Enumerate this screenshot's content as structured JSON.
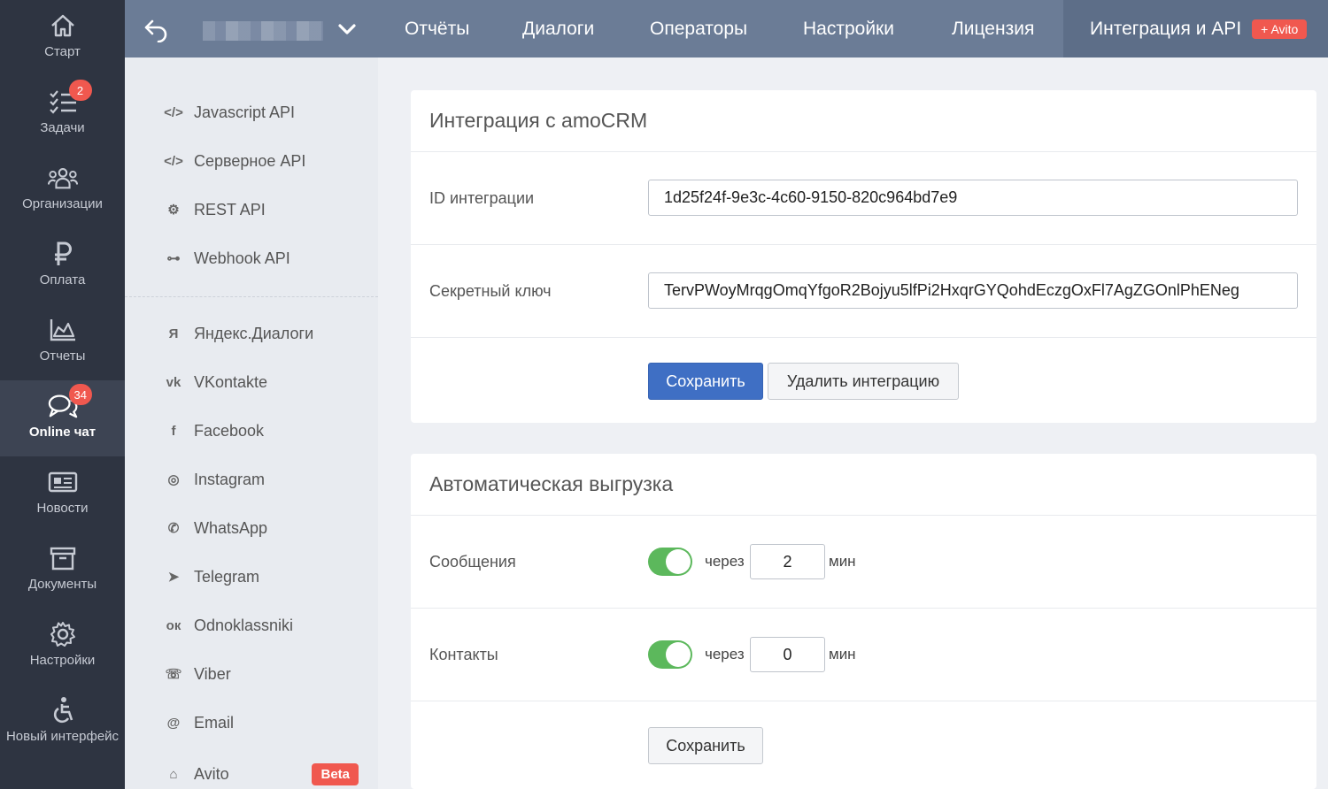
{
  "sidebar": {
    "items": [
      {
        "label": "Старт",
        "icon": "home-icon"
      },
      {
        "label": "Задачи",
        "icon": "tasks-icon",
        "badge": "2"
      },
      {
        "label": "Организации",
        "icon": "organizations-icon"
      },
      {
        "label": "Оплата",
        "icon": "ruble-icon"
      },
      {
        "label": "Отчеты",
        "icon": "chart-icon"
      },
      {
        "label": "Online чат",
        "icon": "chat-icon",
        "badge": "34",
        "active": true
      },
      {
        "label": "Новости",
        "icon": "news-icon"
      },
      {
        "label": "Документы",
        "icon": "archive-icon"
      },
      {
        "label": "Настройки",
        "icon": "gear-icon"
      },
      {
        "label": "Новый интерфейс",
        "icon": "accessibility-icon"
      }
    ]
  },
  "topbar": {
    "tabs": [
      {
        "label": "Отчёты"
      },
      {
        "label": "Диалоги"
      },
      {
        "label": "Операторы"
      },
      {
        "label": "Настройки"
      },
      {
        "label": "Лицензия"
      },
      {
        "label": "Интеграция и API",
        "active": true,
        "badge": "+ Avito"
      }
    ]
  },
  "submenu": {
    "items": [
      {
        "label": "Javascript API",
        "icon": "code-icon",
        "glyph": "</>"
      },
      {
        "label": "Серверное API",
        "icon": "code-icon",
        "glyph": "</>"
      },
      {
        "label": "REST API",
        "icon": "gears-icon",
        "glyph": "⚙"
      },
      {
        "label": "Webhook API",
        "icon": "sitemap-icon",
        "glyph": "⊶"
      },
      {
        "label": "Яндекс.Диалоги",
        "icon": "yandex-icon",
        "glyph": "Я"
      },
      {
        "label": "VKontakte",
        "icon": "vk-icon",
        "glyph": "vk"
      },
      {
        "label": "Facebook",
        "icon": "facebook-icon",
        "glyph": "f"
      },
      {
        "label": "Instagram",
        "icon": "instagram-icon",
        "glyph": "◎"
      },
      {
        "label": "WhatsApp",
        "icon": "whatsapp-icon",
        "glyph": "✆"
      },
      {
        "label": "Telegram",
        "icon": "telegram-icon",
        "glyph": "➤"
      },
      {
        "label": "Odnoklassniki",
        "icon": "odnoklassniki-icon",
        "glyph": "ок"
      },
      {
        "label": "Viber",
        "icon": "viber-icon",
        "glyph": "☏"
      },
      {
        "label": "Email",
        "icon": "at-icon",
        "glyph": "@"
      },
      {
        "label": "Avito",
        "icon": "basket-icon",
        "glyph": "⌂",
        "badge": "Beta"
      }
    ]
  },
  "amocrm": {
    "title": "Интеграция с amoCRM",
    "id_label": "ID интеграции",
    "id_value": "1d25f24f-9e3c-4c60-9150-820c964bd7e9",
    "secret_label": "Секретный ключ",
    "secret_value": "TervPWoyMrqgOmqYfgoR2Bojyu5lfPi2HxqrGYQohdEczgOxFl7AgZGOnlPhENeg",
    "save_label": "Сохранить",
    "delete_label": "Удалить интеграцию"
  },
  "export": {
    "title": "Автоматическая выгрузка",
    "messages_label": "Сообщения",
    "messages_enabled": true,
    "messages_interval": "2",
    "contacts_label": "Контакты",
    "contacts_enabled": true,
    "contacts_interval": "0",
    "through_label": "через",
    "unit_label": "мин",
    "save_label": "Сохранить"
  },
  "colors": {
    "sidebar": "#2e3441",
    "topbar": "#6b7c96",
    "primary": "#3f6fc4",
    "badge": "#f0584f",
    "toggle_on": "#5cb85c"
  }
}
